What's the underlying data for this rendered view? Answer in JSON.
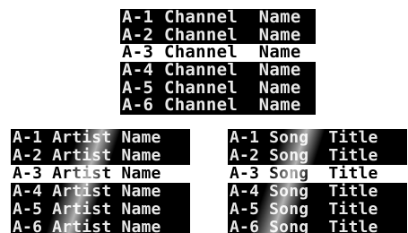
{
  "channels": {
    "items": [
      {
        "label": "A-1 Channel  Name",
        "selected": false
      },
      {
        "label": "A-2 Channel  Name",
        "selected": false
      },
      {
        "label": "A-3 Channel  Name",
        "selected": true
      },
      {
        "label": "A-4 Channel  Name",
        "selected": false
      },
      {
        "label": "A-5 Channel  Name",
        "selected": false
      },
      {
        "label": "A-6 Channel  Name",
        "selected": false
      }
    ]
  },
  "artists": {
    "items": [
      {
        "label": "A-1 Artist Name",
        "selected": false
      },
      {
        "label": "A-2 Artist Name",
        "selected": false
      },
      {
        "label": "A-3 Artist Name",
        "selected": true
      },
      {
        "label": "A-4 Artist Name",
        "selected": false
      },
      {
        "label": "A-5 Artist Name",
        "selected": false
      },
      {
        "label": "A-6 Artist Name",
        "selected": false
      }
    ]
  },
  "songs": {
    "items": [
      {
        "label": "A-1 Song  Title",
        "selected": false
      },
      {
        "label": "A-2 Song  Title",
        "selected": false
      },
      {
        "label": "A-3 Song  Title",
        "selected": true
      },
      {
        "label": "A-4 Song  Title",
        "selected": false
      },
      {
        "label": "A-5 Song  Title",
        "selected": false
      },
      {
        "label": "A-6 Song  Title",
        "selected": false
      }
    ]
  },
  "colors": {
    "row_background": "#000000",
    "row_text": "#e8e8e8",
    "selected_background": "#ffffff",
    "selected_text": "#000000"
  }
}
